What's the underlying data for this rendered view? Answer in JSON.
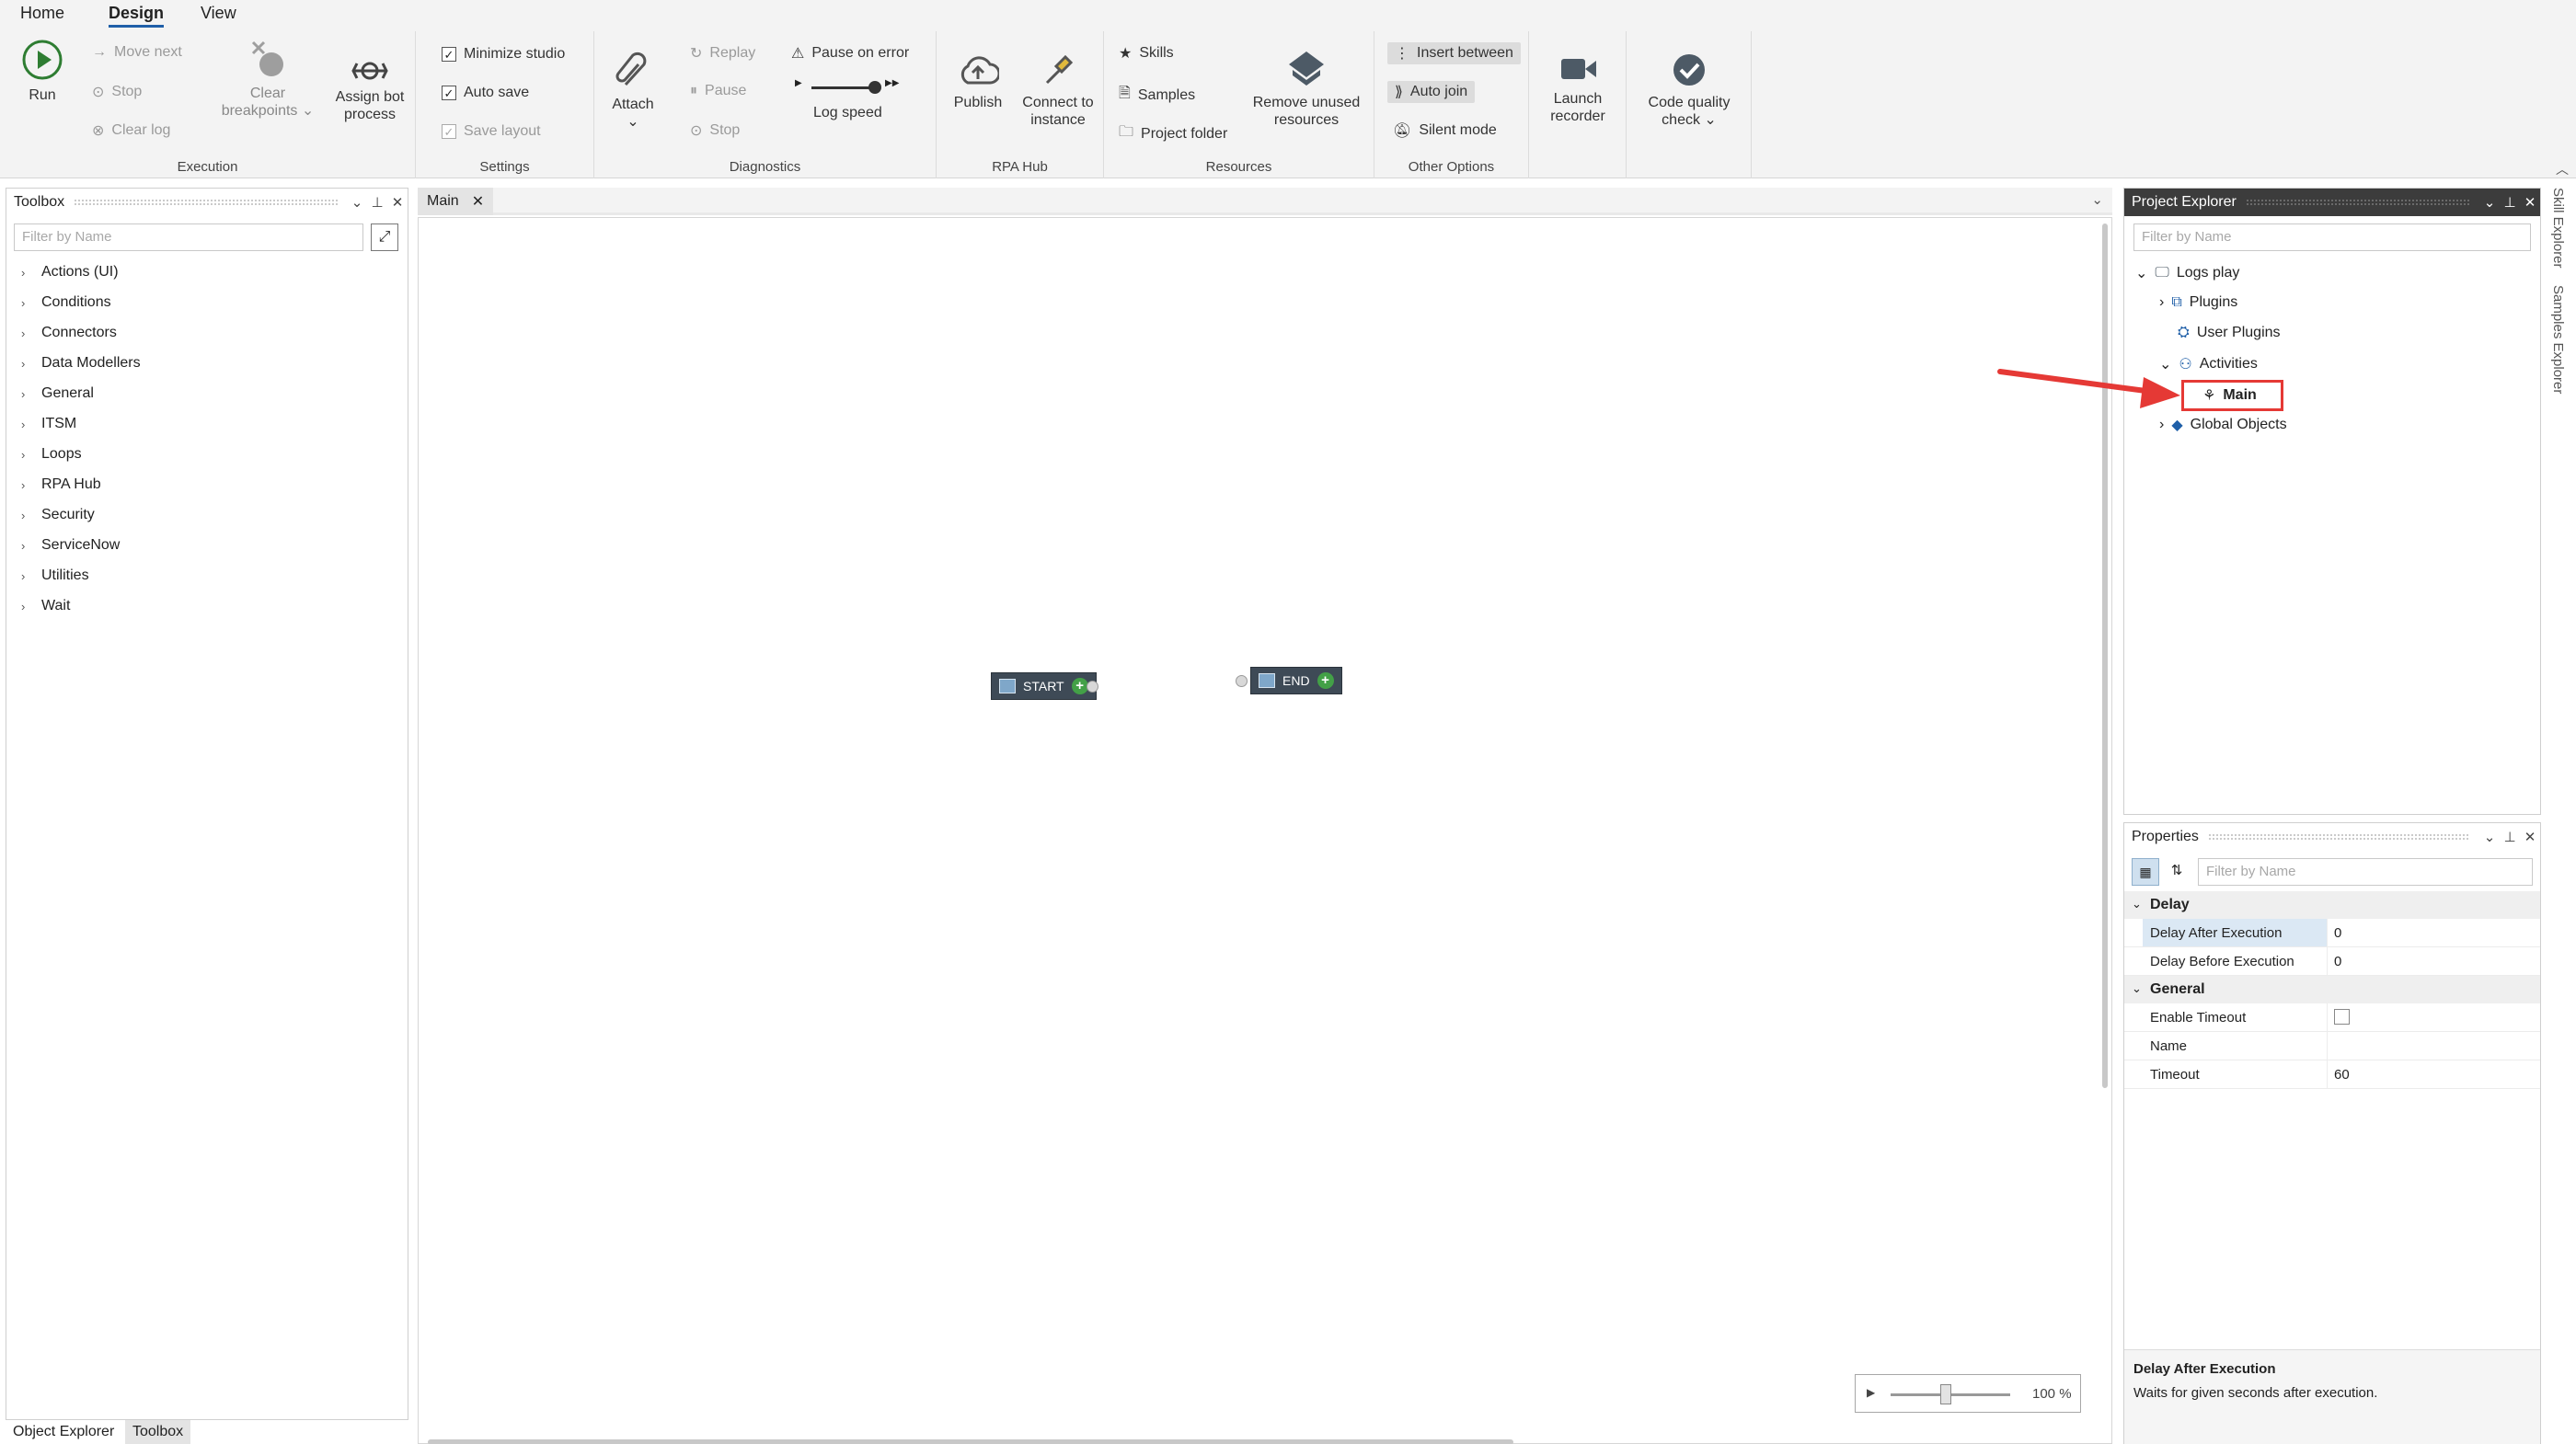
{
  "menu": {
    "tabs": [
      "Home",
      "Design",
      "View"
    ]
  },
  "ribbon": {
    "execution": {
      "run": "Run",
      "move_next": "Move next",
      "stop": "Stop",
      "clear_log": "Clear log",
      "clear_breakpoints": "Clear breakpoints",
      "assign_bot": "Assign bot process",
      "label": "Execution"
    },
    "settings": {
      "minimize_studio": "Minimize studio",
      "auto_save": "Auto save",
      "save_layout": "Save layout",
      "label": "Settings"
    },
    "diagnostics": {
      "attach": "Attach",
      "replay": "Replay",
      "pause": "Pause",
      "stop": "Stop",
      "pause_on_error": "Pause on error",
      "log_speed": "Log speed",
      "label": "Diagnostics"
    },
    "rpa_hub": {
      "publish": "Publish",
      "connect": "Connect to instance",
      "label": "RPA Hub"
    },
    "resources": {
      "skills": "Skills",
      "samples": "Samples",
      "project_folder": "Project folder",
      "remove_unused": "Remove unused resources",
      "label": "Resources"
    },
    "other": {
      "insert_between": "Insert between",
      "auto_join": "Auto join",
      "silent_mode": "Silent mode",
      "label": "Other Options"
    },
    "launch_recorder": "Launch recorder",
    "code_quality": "Code quality check"
  },
  "toolbox": {
    "title": "Toolbox",
    "filter_placeholder": "Filter by Name",
    "items": [
      "Actions (UI)",
      "Conditions",
      "Connectors",
      "Data Modellers",
      "General",
      "ITSM",
      "Loops",
      "RPA Hub",
      "Security",
      "ServiceNow",
      "Utilities",
      "Wait"
    ]
  },
  "bottom_tabs": [
    "Object Explorer",
    "Toolbox"
  ],
  "document": {
    "tab": "Main",
    "start_node": "START",
    "end_node": "END",
    "zoom": "100 %"
  },
  "project_explorer": {
    "title": "Project Explorer",
    "filter_placeholder": "Filter by Name",
    "root": "Logs play",
    "children": [
      "Plugins",
      "User Plugins",
      "Activities",
      "Main",
      "Global Objects"
    ]
  },
  "properties": {
    "title": "Properties",
    "filter_placeholder": "Filter by Name",
    "categories": {
      "delay": "Delay",
      "general": "General"
    },
    "rows": {
      "delay_after": {
        "name": "Delay After Execution",
        "value": "0"
      },
      "delay_before": {
        "name": "Delay Before Execution",
        "value": "0"
      },
      "enable_timeout": {
        "name": "Enable Timeout",
        "value": ""
      },
      "name": {
        "name": "Name",
        "value": ""
      },
      "timeout": {
        "name": "Timeout",
        "value": "60"
      }
    },
    "help_title": "Delay After Execution",
    "help_text": "Waits for given seconds after execution."
  },
  "side_tabs": [
    "Skill Explorer",
    "Samples Explorer"
  ],
  "colors": {
    "accent": "#1f5fa8",
    "highlight": "#e53935",
    "node_bg": "#3e4a56",
    "selected_row": "#dbe8f4"
  }
}
